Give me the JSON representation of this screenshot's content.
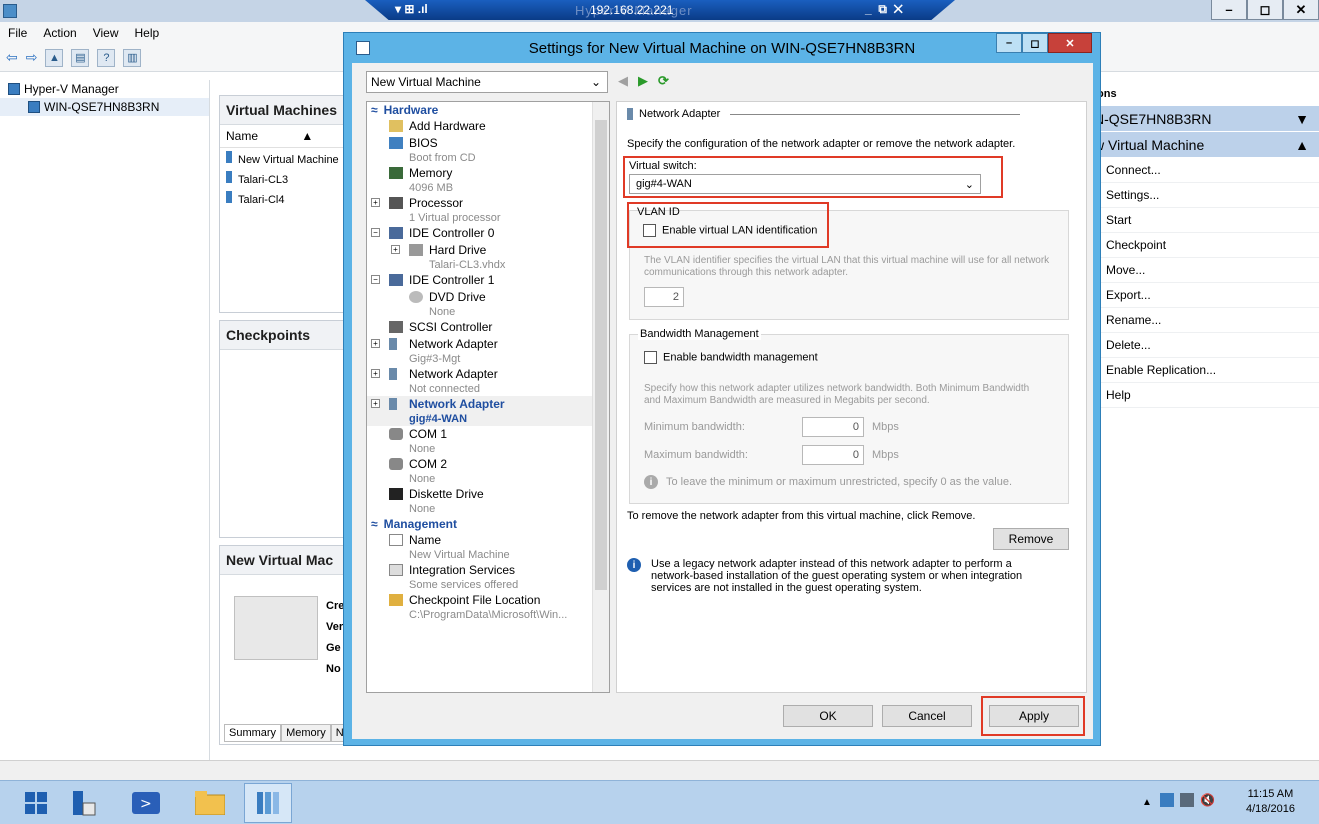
{
  "rdp": {
    "address": "192.168.22.221",
    "ghost_title": "Hyper-V Manager"
  },
  "menu": [
    "File",
    "Action",
    "View",
    "Help"
  ],
  "tree": {
    "root": "Hyper-V Manager",
    "server": "WIN-QSE7HN8B3RN"
  },
  "vms_panel": {
    "title": "Virtual Machines",
    "column": "Name",
    "rows": [
      "New Virtual Machine",
      "Talari-CL3",
      "Talari-Cl4"
    ]
  },
  "checkpoints_panel": {
    "title": "Checkpoints"
  },
  "details_panel": {
    "title": "New Virtual Mac",
    "labels": [
      "Cre",
      "Ver",
      "Ge",
      "No"
    ],
    "tabs": [
      "Summary",
      "Memory",
      "N"
    ]
  },
  "actions": {
    "header_fragment": "ions",
    "server": "N-QSE7HN8B3RN",
    "vm": "w Virtual Machine",
    "items": [
      "Connect...",
      "Settings...",
      "Start",
      "Checkpoint",
      "Move...",
      "Export...",
      "Rename...",
      "Delete...",
      "Enable Replication...",
      "Help"
    ]
  },
  "dialog": {
    "title": "Settings for New Virtual Machine on WIN-QSE7HN8B3RN",
    "vm_select": "New Virtual Machine",
    "hardware_label": "Hardware",
    "management_label": "Management",
    "hardware": [
      {
        "label": "Add Hardware",
        "sub": ""
      },
      {
        "label": "BIOS",
        "sub": "Boot from CD"
      },
      {
        "label": "Memory",
        "sub": "4096 MB"
      },
      {
        "label": "Processor",
        "sub": "1 Virtual processor"
      },
      {
        "label": "IDE Controller 0",
        "sub": ""
      },
      {
        "label": "Hard Drive",
        "sub": "Talari-CL3.vhdx"
      },
      {
        "label": "IDE Controller 1",
        "sub": ""
      },
      {
        "label": "DVD Drive",
        "sub": "None"
      },
      {
        "label": "SCSI Controller",
        "sub": ""
      },
      {
        "label": "Network Adapter",
        "sub": "Gig#3-Mgt"
      },
      {
        "label": "Network Adapter",
        "sub": "Not connected"
      },
      {
        "label": "Network Adapter",
        "sub": "gig#4-WAN"
      },
      {
        "label": "COM 1",
        "sub": "None"
      },
      {
        "label": "COM 2",
        "sub": "None"
      },
      {
        "label": "Diskette Drive",
        "sub": "None"
      }
    ],
    "management": [
      {
        "label": "Name",
        "sub": "New Virtual Machine"
      },
      {
        "label": "Integration Services",
        "sub": "Some services offered"
      },
      {
        "label": "Checkpoint File Location",
        "sub": "C:\\ProgramData\\Microsoft\\Win..."
      }
    ],
    "panel": {
      "heading": "Network Adapter",
      "desc": "Specify the configuration of the network adapter or remove the network adapter.",
      "vswitch_label": "Virtual switch:",
      "vswitch_value": "gig#4-WAN",
      "vlan_group": "VLAN ID",
      "vlan_check": "Enable virtual LAN identification",
      "vlan_desc": "The VLAN identifier specifies the virtual LAN that this virtual machine will use for all network communications through this network adapter.",
      "vlan_value": "2",
      "bw_group": "Bandwidth Management",
      "bw_check": "Enable bandwidth management",
      "bw_desc": "Specify how this network adapter utilizes network bandwidth. Both Minimum Bandwidth and Maximum Bandwidth are measured in Megabits per second.",
      "min_label": "Minimum bandwidth:",
      "min_value": "0",
      "max_label": "Maximum bandwidth:",
      "max_value": "0",
      "unit": "Mbps",
      "bw_note": "To leave the minimum or maximum unrestricted, specify 0 as the value.",
      "remove_text": "To remove the network adapter from this virtual machine, click Remove.",
      "remove_btn": "Remove",
      "legacy_note": "Use a legacy network adapter instead of this network adapter to perform a network-based installation of the guest operating system or when integration services are not installed in the guest operating system."
    },
    "buttons": {
      "ok": "OK",
      "cancel": "Cancel",
      "apply": "Apply"
    }
  },
  "clock": {
    "time": "11:15 AM",
    "date": "4/18/2016"
  }
}
